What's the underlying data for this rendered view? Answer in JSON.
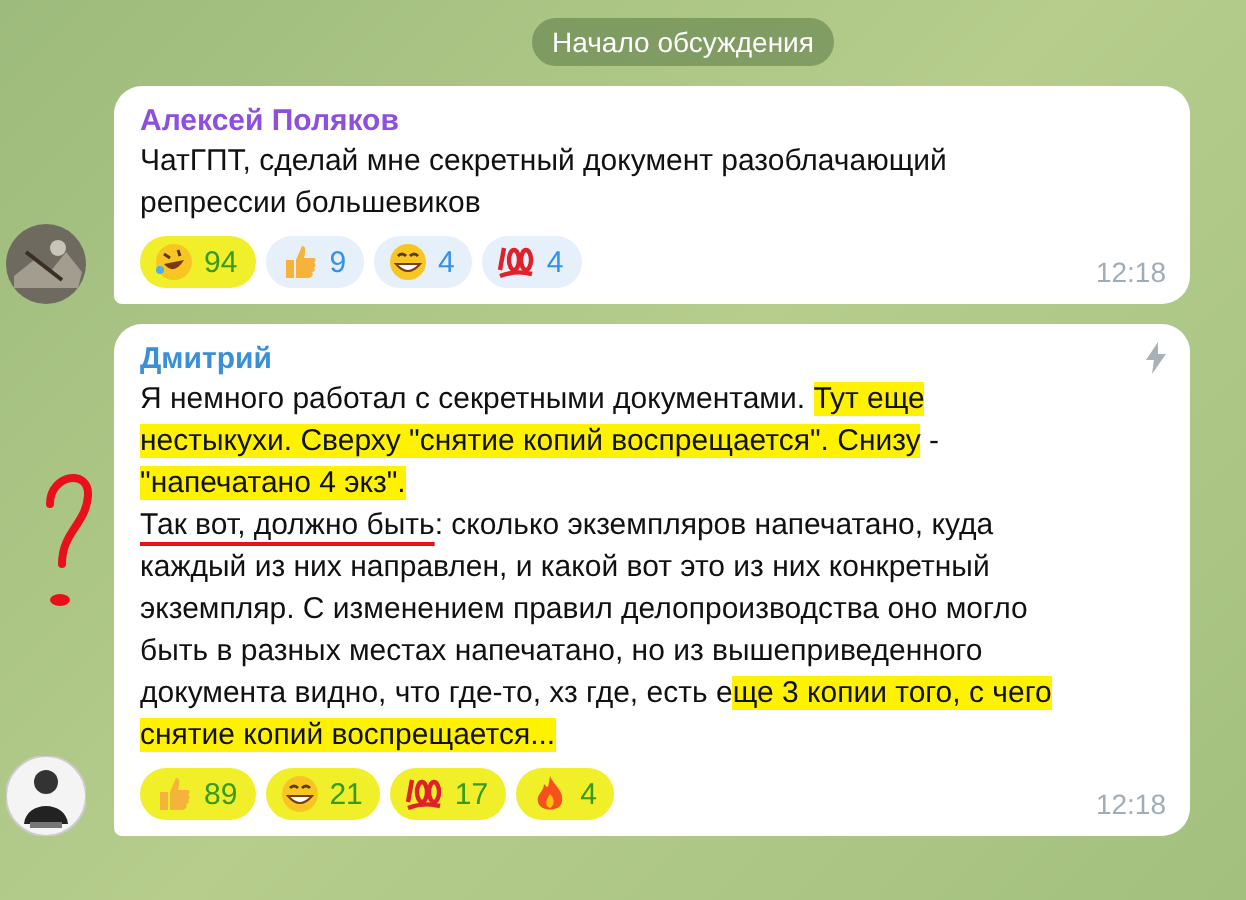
{
  "date_pill": "Начало обсуждения",
  "messages": [
    {
      "author": "Алексей Поляков",
      "color": "#8e4ee0",
      "forwarded_icon": false,
      "avatar": {
        "kind": "photo"
      },
      "paragraphs": [
        [
          {
            "text": "ЧатГПТ, сделай мне секретный документ разоблачающий репрессии большевиков",
            "highlight": false,
            "underline": false
          }
        ]
      ],
      "reactions": [
        {
          "kind": "rofl",
          "count": "94",
          "highlight": true
        },
        {
          "kind": "thumbs",
          "count": "9",
          "highlight": false
        },
        {
          "kind": "grin",
          "count": "4",
          "highlight": false
        },
        {
          "kind": "hundred",
          "count": "4",
          "highlight": false
        }
      ],
      "time": "12:18"
    },
    {
      "author": "Дмитрий",
      "color": "#3a8fd6",
      "annotations": [
        {
          "kind": "question"
        }
      ],
      "forwarded_icon": true,
      "avatar": {
        "kind": "drawing"
      },
      "paragraphs": [
        [
          {
            "text": "Я немного работал с секретными документами. ",
            "highlight": false,
            "underline": false
          },
          {
            "text": "Тут еще нестыкухи. Сверху \"снятие копий воспрещается\". Снизу",
            "highlight": true,
            "underline": false
          },
          {
            "text": " - ",
            "highlight": false,
            "underline": false
          },
          {
            "text": "\"напечатано 4 экз\".",
            "highlight": true,
            "underline": false
          }
        ],
        [
          {
            "text": "Так вот, должно быть",
            "highlight": false,
            "underline": true
          },
          {
            "text": ": сколько экземпляров напечатано, куда каждый из них направлен, и какой вот это из них конкретный экземпляр. С изменением правил делопроизводства оно могло быть в разных местах напечатано, но из вышеприведенного документа видно, что где-то, хз где, есть е",
            "highlight": false,
            "underline": false
          },
          {
            "text": "ще 3 копии того, с чего снятие копий воспрещается...",
            "highlight": true,
            "underline": false
          }
        ]
      ],
      "reactions": [
        {
          "kind": "thumbs",
          "count": "89",
          "highlight": true
        },
        {
          "kind": "grin",
          "count": "21",
          "highlight": true
        },
        {
          "kind": "hundred",
          "count": "17",
          "highlight": true
        },
        {
          "kind": "fire",
          "count": "4",
          "highlight": true
        }
      ],
      "time": "12:18"
    }
  ]
}
